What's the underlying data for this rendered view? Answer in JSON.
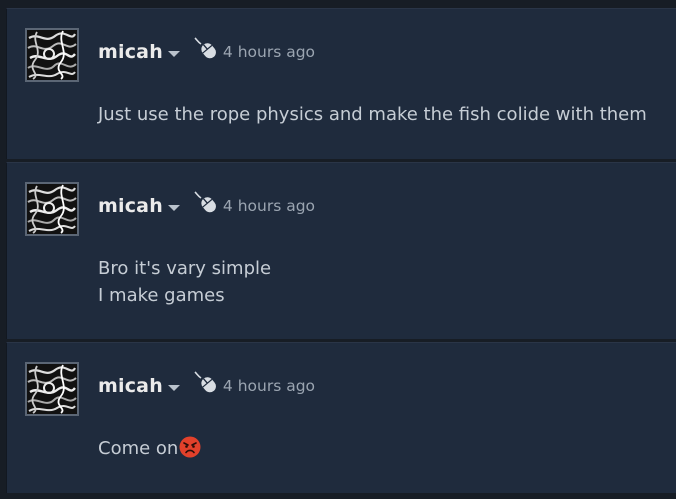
{
  "comments": [
    {
      "author": "micah",
      "time": "4 hours ago",
      "lines": [
        "Just use the rope physics and make the fish colide with them"
      ]
    },
    {
      "author": "micah",
      "time": "4 hours ago",
      "lines": [
        "Bro it's vary simple",
        "I make games"
      ]
    },
    {
      "author": "micah",
      "time": "4 hours ago",
      "lines": [
        "Come on"
      ],
      "emoji": "angry-face-icon"
    }
  ],
  "colors": {
    "page_bg": "#171d25",
    "card_bg": "#1f2b3d",
    "author": "#ebebeb",
    "timestamp": "#9ba5b1",
    "body_text": "#c6cdd5",
    "emoji_red": "#e2412b"
  },
  "icons": [
    "avatar-image",
    "chevron-down-icon",
    "mouse-icon",
    "angry-face-icon"
  ]
}
